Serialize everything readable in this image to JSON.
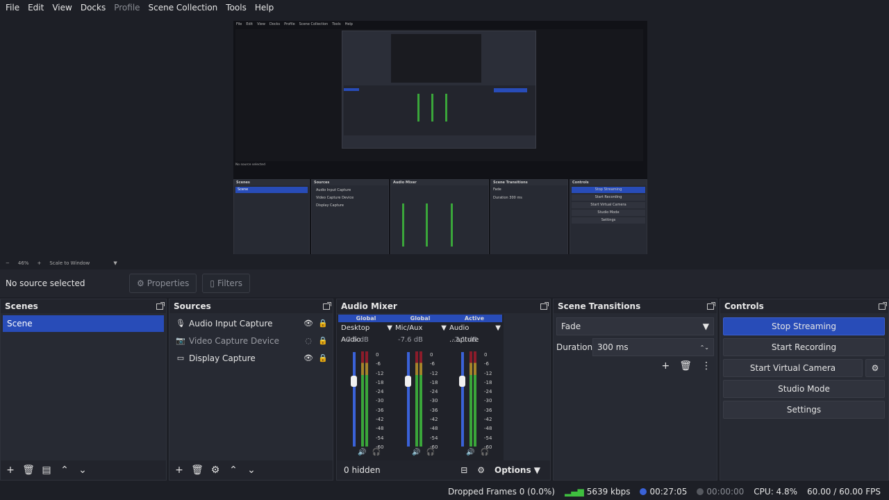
{
  "menu": {
    "items": [
      {
        "label": "File"
      },
      {
        "label": "Edit"
      },
      {
        "label": "View"
      },
      {
        "label": "Docks"
      },
      {
        "label": "Profile"
      },
      {
        "label": "Scene Collection"
      },
      {
        "label": "Tools"
      },
      {
        "label": "Help"
      }
    ]
  },
  "zoom": {
    "minus": "−",
    "level": "46%",
    "plus": "+",
    "mode": "Scale to Window"
  },
  "source_bar": {
    "no_source": "No source selected",
    "properties": "Properties",
    "filters": "Filters"
  },
  "scenes": {
    "title": "Scenes",
    "items": [
      "Scene"
    ]
  },
  "sources": {
    "title": "Sources",
    "items": [
      {
        "label": "Audio Input Capture"
      },
      {
        "label": "Video Capture Device"
      },
      {
        "label": "Display Capture"
      }
    ]
  },
  "mixer": {
    "title": "Audio Mixer",
    "channels": [
      {
        "tag": "Global",
        "name": "Desktop Audio",
        "db": "-7.6 dB",
        "level": 0.82
      },
      {
        "tag": "Global",
        "name": "Mic/Aux",
        "db": "-7.6 dB",
        "level": 0.82
      },
      {
        "tag": "Active",
        "name": "Audio ...apture",
        "db": "-7.1 dB",
        "level": 0.8
      }
    ],
    "scale": [
      "0",
      "-6",
      "-12",
      "-18",
      "-24",
      "-30",
      "-36",
      "-42",
      "-48",
      "-54",
      "-60"
    ],
    "hidden": "0 hidden",
    "options": "Options"
  },
  "transitions": {
    "title": "Scene Transitions",
    "type": "Fade",
    "duration_label": "Duration",
    "duration": "300 ms"
  },
  "controls": {
    "title": "Controls",
    "stop_streaming": "Stop Streaming",
    "start_recording": "Start Recording",
    "start_virtual_camera": "Start Virtual Camera",
    "studio_mode": "Studio Mode",
    "settings": "Settings"
  },
  "status": {
    "dropped": "Dropped Frames 0 (0.0%)",
    "bitrate": "5639 kbps",
    "stream_time": "00:27:05",
    "rec_time": "00:00:00",
    "cpu": "CPU: 4.8%",
    "fps": "60.00 / 60.00 FPS"
  },
  "colors": {
    "accent": "#284cb8",
    "bg": "#1d1f26",
    "panel": "#272a33"
  }
}
